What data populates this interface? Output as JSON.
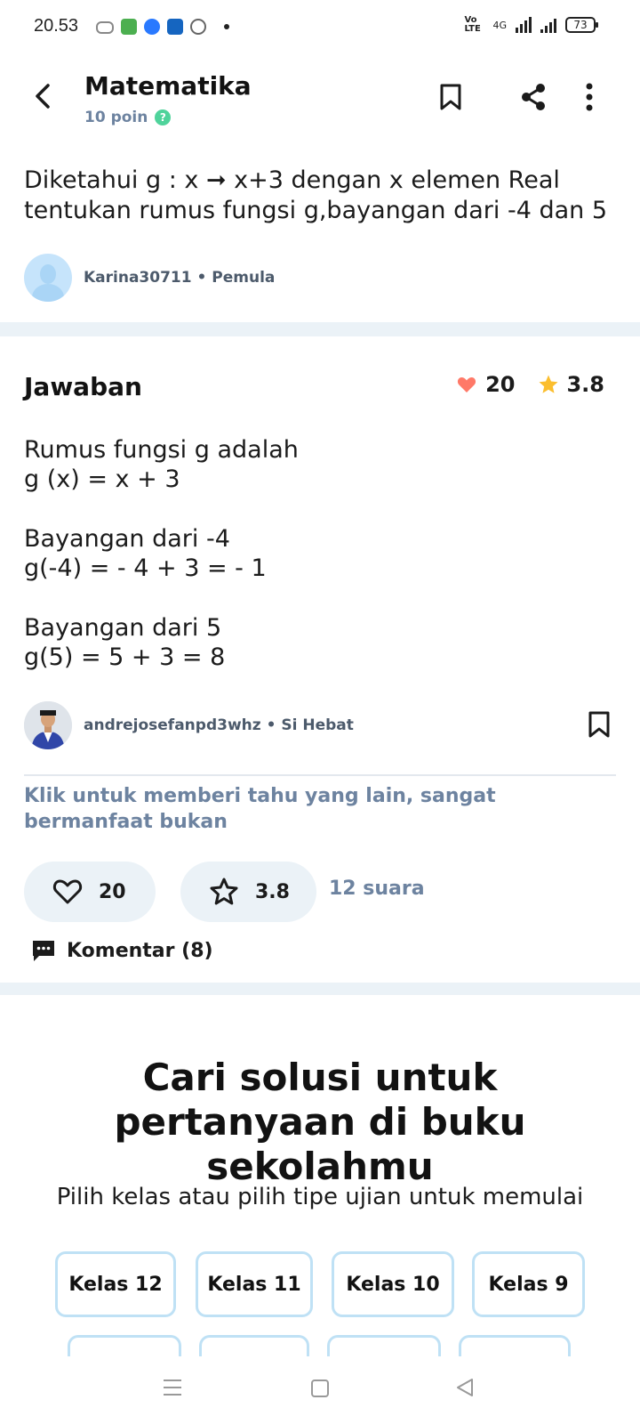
{
  "status_bar": {
    "time": "20.53",
    "volte": "Vo LTE",
    "network": "4G",
    "battery": "73"
  },
  "header": {
    "title": "Matematika",
    "points": "10 poin"
  },
  "question": {
    "text": "Diketahui g : x ➞ x+3 dengan x elemen Real\ntentukan rumus fungsi g,bayangan dari -4 dan 5",
    "author": "Karina30711 • Pemula"
  },
  "answer": {
    "title": "Jawaban",
    "likes": "20",
    "rating": "3.8",
    "lines": {
      "l1": "Rumus fungsi g adalah",
      "l2": "g (x) = x + 3",
      "l3": "Bayangan dari -4",
      "l4": "g(-4) = - 4 + 3 = - 1",
      "l5": "Bayangan dari 5",
      "l6": "g(5) = 5 + 3 = 8"
    },
    "author": "andrejosefanpd3whz • Si Hebat",
    "thanks_prompt": "Klik untuk memberi tahu yang lain, sangat bermanfaat bukan",
    "like_count": "20",
    "rate_value": "3.8",
    "votes": "12 suara",
    "comments": "Komentar (8)"
  },
  "search_section": {
    "title": "Cari solusi untuk pertanyaan di buku sekolahmu",
    "subtitle": "Pilih kelas atau pilih tipe ujian untuk memulai",
    "grades": [
      "Kelas 12",
      "Kelas 11",
      "Kelas 10",
      "Kelas 9"
    ]
  },
  "colors": {
    "accent_muted": "#6d83a0",
    "heart": "#ff7968",
    "star": "#fbbe2e",
    "band": "#ebf2f7",
    "grade_border": "#bfe1f5"
  }
}
